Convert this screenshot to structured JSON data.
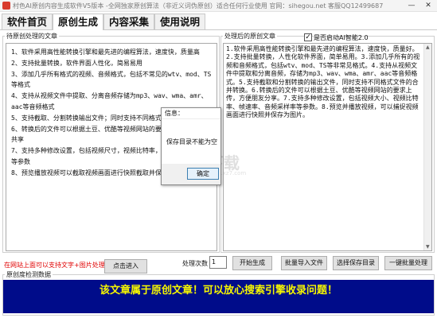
{
  "window": {
    "title": "村色AI原创内容生成软件V5版本 -全网独家原创算法（非近义词伪原创）适合任何行业使用 官网：sihegou.net 客服QQ12499687",
    "minimize_glyph": "—",
    "close_glyph": "✕"
  },
  "tabs": [
    {
      "label": "软件首页",
      "active": false
    },
    {
      "label": "原创生成",
      "active": true
    },
    {
      "label": "内容采集",
      "active": false
    },
    {
      "label": "使用说明",
      "active": false
    }
  ],
  "original_panel": {
    "label": "待原创处理的文章",
    "paragraphs": [
      "1、软件采用高性能转换引擎和最先进的编程算法，速度快，质量高",
      "2、支持批量转换，软件界面人性化，简易易用",
      "3、添加几乎所有格式的视频、音频格式，包括不常见的wtv、mod、TS等格式",
      "4、支持从视频文件中提取、分离音频存储为mp3、wav、wma、amr、aac等音频格式",
      "5、支持截取、分割转换输出文件；同时支持不同格式文件合并为一格式",
      "6、转换后的文件可以根据土豆、优酷等视频网站的要求，方便上传朋友共享",
      "7、支持多种修改设置，包括视频尺寸，视频比特率，帧率，音频采样率等参数",
      "8、预览播放视频可以截取视频画面进行快照截取并保存为图片"
    ]
  },
  "result_panel": {
    "label": "处理后的原创文章",
    "ai_checkbox_label": "是否启动AI智能2.0",
    "ai_checkbox_checked": true,
    "check_glyph": "✓",
    "text": "1.软件采用高性能转换引擎和最先进的编程算法，速度快，质量好。2.支持批量转换，人性化软件界面，简单易用。3.添加几乎所有的视频和音频格式，包括wtv、mod、TS等非常见格式。4.支持从视频文件中提取和分离音频，存储为mp3、wav、wma、amr、aac等音频格式。5.支持截取和分割转换的输出文件，同时支持不同格式文件的合并转换。6.转换后的文件可以根据土豆、优酷等视频网站的要求上传，方便朋友分享。7.支持多种修改设置，包括视频大小、视频比特率、帧速率、音频采样率等参数。8.预览并播放视频，可以捕捉视频画面进行快照并保存为图片。"
  },
  "dialog": {
    "title": "信息：",
    "message": "保存目录不能为空",
    "ok_label": "确定"
  },
  "watermark": {
    "text": "下载",
    "sub": "www.xz7.com"
  },
  "controls": {
    "link_text": "在网站上面可以支持文字+图片处理",
    "click_enter": "点击进入",
    "count_label": "处理次数",
    "count_value": "1",
    "start": "开始生成",
    "batch_import": "批量导入文件",
    "choose_dir": "选择保存目录",
    "one_click": "一键批量处理"
  },
  "detection": {
    "label": "原创度检测数据",
    "message": "该文章属于原创文章！可以放心搜索引擎收录问题！"
  },
  "colors": {
    "banner_bg": "#000c8a",
    "banner_text": "#f6f600",
    "link_red": "#e00000"
  }
}
